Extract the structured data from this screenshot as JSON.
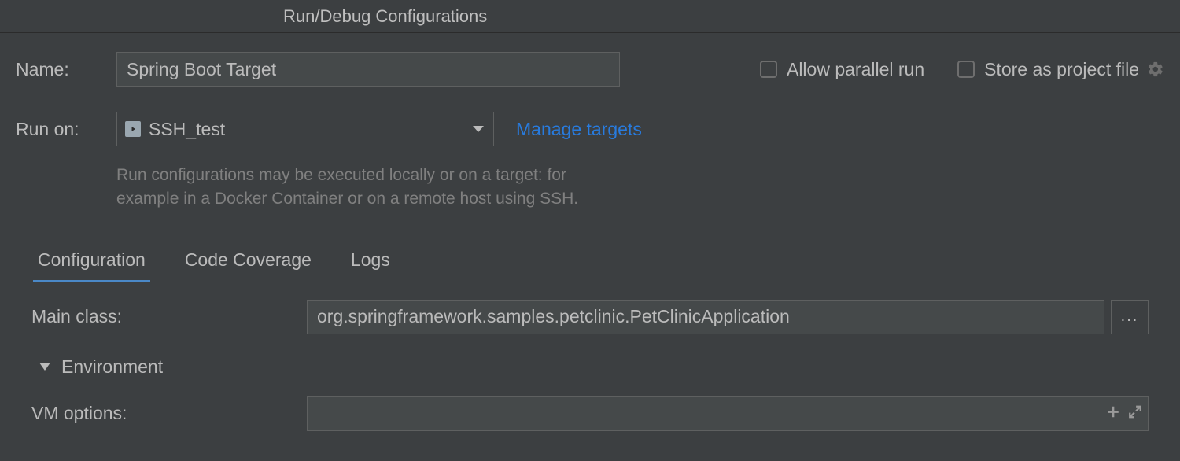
{
  "title": "Run/Debug Configurations",
  "name_label": "Name:",
  "name_value": "Spring Boot Target",
  "allow_parallel_label": "Allow parallel run",
  "store_project_label": "Store as project file",
  "run_on_label": "Run on:",
  "run_on_value": "SSH_test",
  "manage_targets": "Manage targets",
  "help_line1": "Run configurations may be executed locally or on a target: for",
  "help_line2": "example in a Docker Container or on a remote host using SSH.",
  "tabs": {
    "configuration": "Configuration",
    "code_coverage": "Code Coverage",
    "logs": "Logs"
  },
  "main_class_label": "Main class:",
  "main_class_value": "org.springframework.samples.petclinic.PetClinicApplication",
  "browse_label": "...",
  "environment_label": "Environment",
  "vm_options_label": "VM options:",
  "vm_options_value": ""
}
